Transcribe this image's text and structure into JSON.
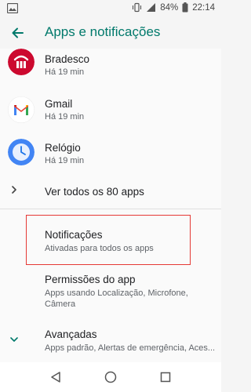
{
  "status_bar": {
    "battery": "84%",
    "time": "22:14"
  },
  "app_bar": {
    "title": "Apps e notificações"
  },
  "recent_apps": [
    {
      "name": "Bradesco",
      "time": "Há 19 min",
      "icon": "bradesco-icon",
      "color": "#cc092f"
    },
    {
      "name": "Gmail",
      "time": "Há 19 min",
      "icon": "gmail-icon",
      "color": "#ea4335"
    },
    {
      "name": "Relógio",
      "time": "Há 19 min",
      "icon": "clock-app-icon",
      "color": "#4285f4"
    }
  ],
  "see_all": {
    "label": "Ver todos os 80 apps"
  },
  "settings": [
    {
      "title": "Notificações",
      "subtitle": "Ativadas para todos os apps"
    },
    {
      "title": "Permissões do app",
      "subtitle_line1": "Apps usando Localização, Microfone,",
      "subtitle_line2": "Câmera"
    },
    {
      "title": "Avançadas",
      "subtitle": "Apps padrão, Alertas de emergência, Aces..."
    }
  ],
  "colors": {
    "accent": "#00796b",
    "highlight": "#e53935"
  }
}
